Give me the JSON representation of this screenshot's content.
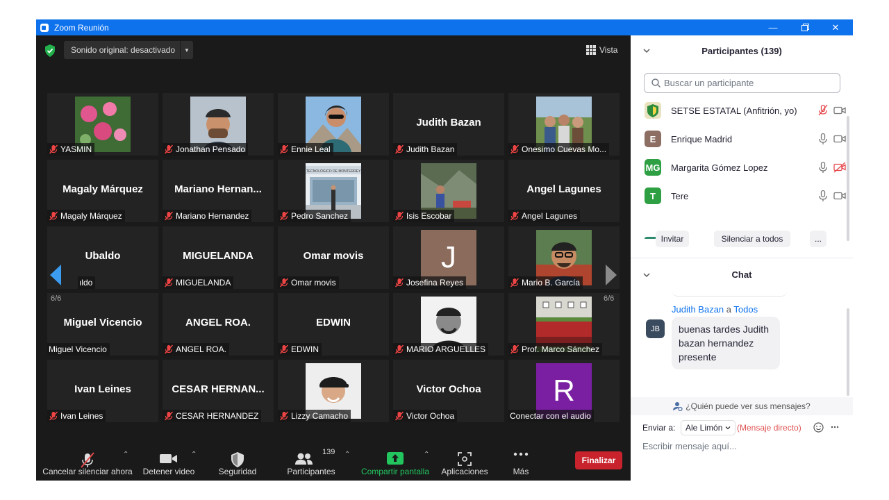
{
  "window": {
    "title": "Zoom Reunión"
  },
  "top_bar": {
    "sound_label": "Sonido original: desactivado",
    "view_label": "Vista"
  },
  "tiles": [
    {
      "name": "YASMIN",
      "big": "",
      "photo": "flowers",
      "muted": true
    },
    {
      "name": "Jonathan Pensado",
      "big": "",
      "photo": "man-cap",
      "muted": true
    },
    {
      "name": "Ennie Leal",
      "big": "",
      "photo": "woman-selfie",
      "muted": true
    },
    {
      "name": "Judith Bazan",
      "big": "Judith Bazan",
      "photo": "",
      "muted": true
    },
    {
      "name": "Onesimo Cuevas Mo...",
      "big": "",
      "photo": "group",
      "muted": true
    },
    {
      "name": "Magaly Márquez",
      "big": "Magaly Márquez",
      "photo": "",
      "muted": true
    },
    {
      "name": "Mariano Hernandez",
      "big": "Mariano  Hernan...",
      "photo": "",
      "muted": true
    },
    {
      "name": "Pedro Sanchez",
      "big": "",
      "photo": "building",
      "muted": true
    },
    {
      "name": "Isis Escobar",
      "big": "",
      "photo": "mountain",
      "muted": true
    },
    {
      "name": "Angel Lagunes",
      "big": "Angel Lagunes",
      "photo": "",
      "muted": true
    },
    {
      "name": "ıldo",
      "big": "Ubaldo",
      "photo": "",
      "muted": false
    },
    {
      "name": "MIGUELANDA",
      "big": "MIGUELANDA",
      "photo": "",
      "muted": true
    },
    {
      "name": "Omar movis",
      "big": "Omar movis",
      "photo": "",
      "muted": true
    },
    {
      "name": "Josefina Reyes",
      "big": "",
      "photo": "letter-j",
      "muted": true
    },
    {
      "name": "Mario B. García",
      "big": "",
      "photo": "man-glasses",
      "muted": true
    },
    {
      "name": "Miguel Vicencio",
      "big": "Miguel Vicencio",
      "photo": "",
      "muted": false
    },
    {
      "name": "ANGEL ROA.",
      "big": "ANGEL ROA.",
      "photo": "",
      "muted": true
    },
    {
      "name": "EDWIN",
      "big": "EDWIN",
      "photo": "",
      "muted": true
    },
    {
      "name": "MARIO ARGUELLES",
      "big": "",
      "photo": "man-bw",
      "muted": true
    },
    {
      "name": "Prof. Marco Sánchez",
      "big": "",
      "photo": "team",
      "muted": true
    },
    {
      "name": "Ivan Leines",
      "big": "Ivan Leines",
      "photo": "",
      "muted": true
    },
    {
      "name": "CESAR HERNANDEZ",
      "big": "CESAR  HERNAN...",
      "photo": "",
      "muted": true
    },
    {
      "name": "Lizzy Camacho",
      "big": "",
      "photo": "woman-cap",
      "muted": true
    },
    {
      "name": "Victor Ochoa",
      "big": "Victor Ochoa",
      "photo": "",
      "muted": true
    },
    {
      "name": "Conectar con el audio",
      "big": "",
      "photo": "letter-r",
      "muted": false
    }
  ],
  "letters": {
    "j": "J",
    "r": "R"
  },
  "pagination": {
    "left": "6/6",
    "right": "6/6"
  },
  "toolbar": {
    "mute": "Cancelar silenciar ahora",
    "video": "Detener video",
    "security": "Seguridad",
    "participants": "Participantes",
    "participant_count": "139",
    "share": "Compartir pantalla",
    "apps": "Aplicaciones",
    "more": "Más",
    "end": "Finalizar"
  },
  "participants_panel": {
    "title": "Participantes (139)",
    "search_placeholder": "Buscar un participante",
    "people": [
      {
        "name": "SETSE ESTATAL (Anfitrión, yo)",
        "initials": "",
        "color": "#2d8c3c"
      },
      {
        "name": "Enrique Madrid",
        "initials": "E",
        "color": "#8d6e63"
      },
      {
        "name": "Margarita Gómez Lopez",
        "initials": "MG",
        "color": "#2ea043"
      },
      {
        "name": "Tere",
        "initials": "T",
        "color": "#2ea043"
      }
    ],
    "invite": "Invitar",
    "mute_all": "Silenciar a todos",
    "more": "..."
  },
  "chat": {
    "title": "Chat",
    "sender": "Judith Bazan",
    "to_word": "a",
    "to": "Todos",
    "avatar": "JB",
    "message": "buenas tardes Judith bazan hernandez presente",
    "who_can_see": "¿Quién puede ver sus mensajes?",
    "send_to_label": "Enviar a:",
    "recipient": "Ale Limón",
    "direct": "(Mensaje directo)",
    "input_placeholder": "Escribir mensaje aquí..."
  },
  "colors": {
    "accent": "#0e72ed",
    "end": "#c8232c",
    "share": "#22c55e",
    "link": "#0e72ed",
    "direct": "#e05454"
  }
}
